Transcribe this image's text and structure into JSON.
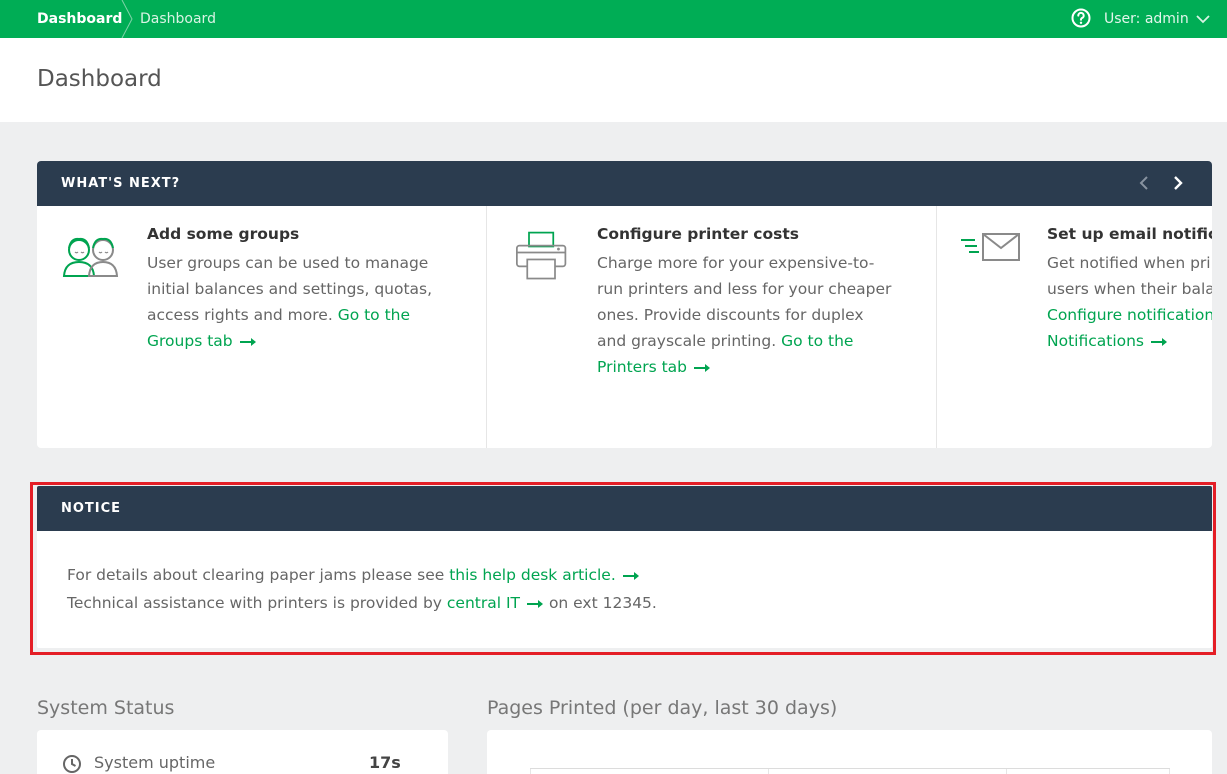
{
  "topbar": {
    "breadcrumb_active": "Dashboard",
    "breadcrumb_current": "Dashboard",
    "user_menu": "User: admin"
  },
  "page": {
    "title": "Dashboard"
  },
  "whats_next": {
    "heading": "WHAT'S NEXT?",
    "cards": [
      {
        "icon": "users-group-icon",
        "title": "Add some groups",
        "text": "User groups can be used to manage initial balances and settings, quotas, access rights and more.",
        "link": "Go to the Groups tab"
      },
      {
        "icon": "printer-icon",
        "title": "Configure printer costs",
        "text": "Charge more for your expensive-to-run printers and less for your cheaper ones. Provide discounts for duplex and grayscale printing.",
        "link": "Go to the Printers tab"
      },
      {
        "icon": "email-icon",
        "title": "Set up email notifica",
        "line1": "Get notified when pri",
        "line2": "users when their bala",
        "link1": "Configure notification",
        "link2": "Notifications"
      }
    ]
  },
  "notice": {
    "heading": "NOTICE",
    "line1_text": "For details about clearing paper jams please see",
    "line1_link": "this help desk article.",
    "line2_text": "Technical assistance with printers is provided by",
    "line2_link": "central IT",
    "line2_suffix": "on ext 12345."
  },
  "system_status": {
    "title": "System Status",
    "uptime_label": "System uptime",
    "uptime_value": "17s"
  },
  "pages_printed": {
    "title": "Pages Printed (per day, last 30 days)"
  },
  "colors": {
    "topbar": "#00ad55",
    "panel_header": "#2b3c4f",
    "link": "#00a450",
    "highlight": "#e41e26"
  }
}
